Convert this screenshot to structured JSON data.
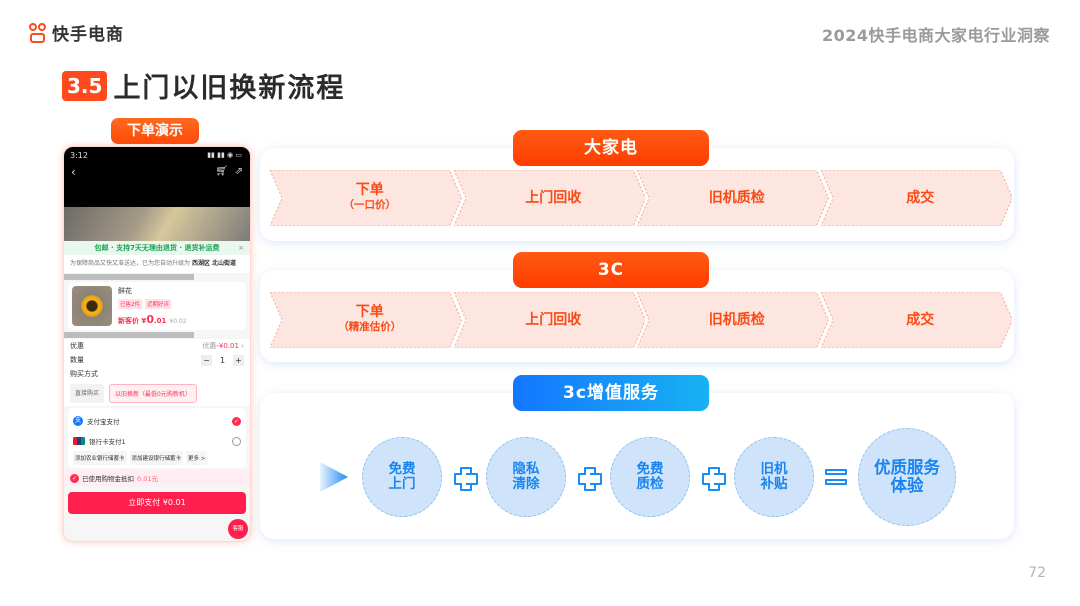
{
  "header": {
    "brand_name": "快手电商",
    "report_title": "2024快手电商大家电行业洞察"
  },
  "section": {
    "number": "3.5",
    "title": "上门以旧换新流程"
  },
  "demo": {
    "label": "下单演示",
    "phone": {
      "time": "3:12",
      "status_icons": "▮▮ ▮▮ ◉ ▭",
      "banner": "包邮 · 支持7天无理由退货 · 退货补运费",
      "notice_prefix": "为保障商品又快又准送达，已为您自动升级为",
      "notice_highlight": "西湖区 北山街道",
      "product_name": "鲜花",
      "product_tags": [
        "已售2件",
        "近期好评"
      ],
      "price_label": "新客价 ¥",
      "price_main": "0",
      "price_decimal": ".01",
      "price_original": "¥0.02",
      "discount_label": "优惠",
      "discount_value_prefix": "优惠",
      "discount_value": "-¥0.01",
      "quantity_label": "数量",
      "quantity_value": "1",
      "buy_method_label": "购买方式",
      "buy_options": [
        "直接购买",
        "以旧换新（最低0元购新机）"
      ],
      "payment_methods": [
        {
          "label": "支付宝支付",
          "selected": true
        },
        {
          "label": "银行卡支付1",
          "selected": false
        }
      ],
      "bank_options": [
        "添加农业银行储蓄卡",
        "添加建设银行储蓄卡",
        "更多 >"
      ],
      "deduction_text": "已使用购物金抵扣",
      "deduction_value": "0.01元",
      "pay_button": "立即支付 ¥0.01",
      "service_button": "客服"
    }
  },
  "flows": [
    {
      "title": "大家电",
      "steps": [
        {
          "label": "下单",
          "sub": "（一口价）"
        },
        {
          "label": "上门回收",
          "sub": ""
        },
        {
          "label": "旧机质检",
          "sub": ""
        },
        {
          "label": "成交",
          "sub": ""
        }
      ]
    },
    {
      "title": "3C",
      "steps": [
        {
          "label": "下单",
          "sub": "（精准估价）"
        },
        {
          "label": "上门回收",
          "sub": ""
        },
        {
          "label": "旧机质检",
          "sub": ""
        },
        {
          "label": "成交",
          "sub": ""
        }
      ]
    }
  ],
  "services": {
    "title": "3c增值服务",
    "items": [
      {
        "line1": "免费",
        "line2": "上门"
      },
      {
        "line1": "隐私",
        "line2": "清除"
      },
      {
        "line1": "免费",
        "line2": "质检"
      },
      {
        "line1": "旧机",
        "line2": "补贴"
      }
    ],
    "result": {
      "line1": "优质服务",
      "line2": "体验"
    }
  },
  "page_number": "72",
  "colors": {
    "brand_orange": "#fe4a1c",
    "step_text": "#fa4a14",
    "step_fill": "#fde5e0",
    "service_blue": "#1a84f0",
    "circle_fill": "#cfe4fb"
  }
}
